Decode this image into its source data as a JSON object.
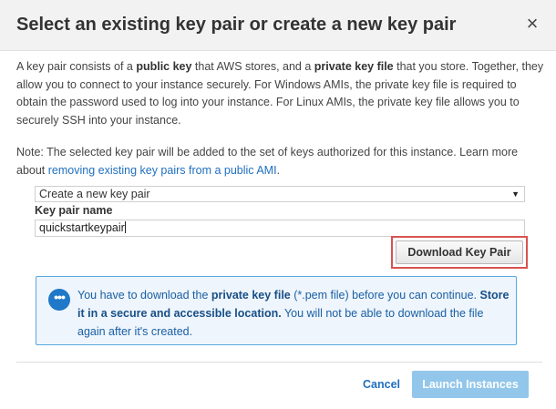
{
  "dialog": {
    "title": "Select an existing key pair or create a new key pair",
    "close_glyph": "×"
  },
  "intro": {
    "t1": "A key pair consists of a ",
    "b1": "public key",
    "t2": " that AWS stores, and a ",
    "b2": "private key file",
    "t3": " that you store. Together, they allow you to connect to your instance securely. For Windows AMIs, the private key file is required to obtain the password used to log into your instance. For Linux AMIs, the private key file allows you to securely SSH into your instance."
  },
  "note": {
    "text": "Note: The selected key pair will be added to the set of keys authorized for this instance. Learn more about ",
    "link": "removing existing key pairs from a public AMI",
    "end": "."
  },
  "key_pair": {
    "select_value": "Create a new key pair",
    "name_label": "Key pair name",
    "name_value": "quickstartkeypair",
    "download_label": "Download Key Pair"
  },
  "info": {
    "t1": "You have to download the ",
    "b1": "private key file",
    "t2": " (*.pem file) before you can continue. ",
    "b2": "Store it in a secure and accessible location.",
    "t3": " You will not be able to download the file again after it's created."
  },
  "footer": {
    "cancel_label": "Cancel",
    "launch_label": "Launch Instances"
  },
  "icons": {
    "close": "close-icon",
    "info": "info-chat-icon",
    "dropdown": "chevron-down-icon"
  },
  "colors": {
    "link": "#1f6fbf",
    "info_border": "#5aa8e0",
    "info_background": "#eef5fc",
    "highlight": "#d9534f",
    "launch_disabled": "#92c6ea"
  }
}
